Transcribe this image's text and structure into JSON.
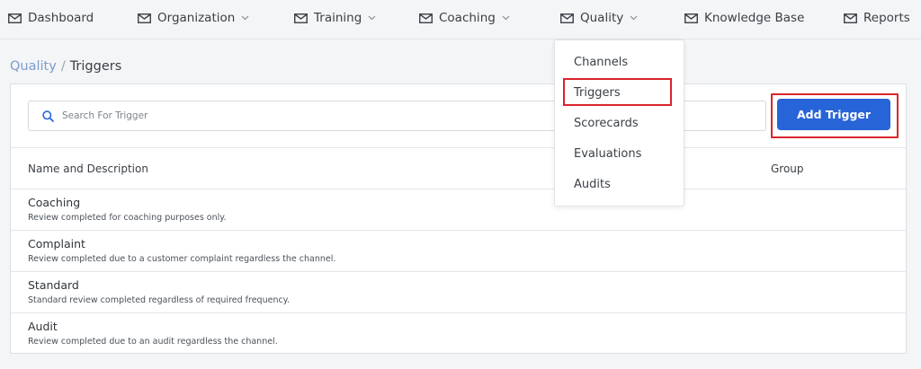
{
  "nav": {
    "dashboard": "Dashboard",
    "organization": "Organization",
    "training": "Training",
    "coaching": "Coaching",
    "quality": "Quality",
    "knowledge_base": "Knowledge Base",
    "reports": "Reports"
  },
  "breadcrumb": {
    "parent": "Quality",
    "separator": "/",
    "current": "Triggers"
  },
  "search": {
    "placeholder": "Search For Trigger",
    "value": ""
  },
  "add_button": {
    "label": "Add Trigger"
  },
  "table": {
    "columns": {
      "name": "Name and Description",
      "group": "Group"
    },
    "rows": [
      {
        "title": "Coaching",
        "description": "Review completed for coaching purposes only."
      },
      {
        "title": "Complaint",
        "description": "Review completed due to a customer complaint regardless the channel."
      },
      {
        "title": "Standard",
        "description": "Standard review completed regardless of required frequency."
      },
      {
        "title": "Audit",
        "description": "Review completed due to an audit regardless the channel."
      }
    ]
  },
  "quality_menu": {
    "items": [
      "Channels",
      "Triggers",
      "Scorecards",
      "Evaluations",
      "Audits"
    ],
    "highlighted": "Triggers"
  },
  "colors": {
    "primary_button": "#2764d8",
    "highlight_border": "#d9242c",
    "breadcrumb_link": "#7c9cc9"
  },
  "icons": {
    "nav_item": "envelope-icon",
    "dropdown_indicator": "chevron-down-icon",
    "search": "search-icon"
  }
}
